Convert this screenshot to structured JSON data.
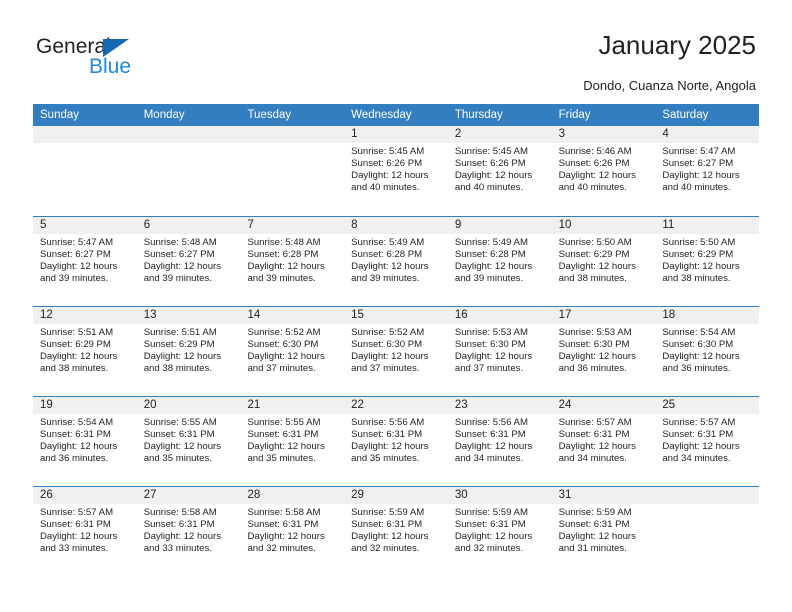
{
  "logo": {
    "text_top": "General",
    "text_bottom": "Blue",
    "triangle_color": "#1668b3",
    "blue_color": "#2288d6"
  },
  "header": {
    "title": "January 2025",
    "subtitle": "Dondo, Cuanza Norte, Angola"
  },
  "theme": {
    "header_blue": "#337ec0",
    "day_band_gray": "#f0f0f0",
    "text_color": "#231f20"
  },
  "calendar": {
    "weekdays": [
      "Sunday",
      "Monday",
      "Tuesday",
      "Wednesday",
      "Thursday",
      "Friday",
      "Saturday"
    ],
    "weeks": [
      [
        {
          "day": "",
          "sunrise": "",
          "sunset": "",
          "daylight_1": "",
          "daylight_2": ""
        },
        {
          "day": "",
          "sunrise": "",
          "sunset": "",
          "daylight_1": "",
          "daylight_2": ""
        },
        {
          "day": "",
          "sunrise": "",
          "sunset": "",
          "daylight_1": "",
          "daylight_2": ""
        },
        {
          "day": "1",
          "sunrise": "Sunrise: 5:45 AM",
          "sunset": "Sunset: 6:26 PM",
          "daylight_1": "Daylight: 12 hours",
          "daylight_2": "and 40 minutes."
        },
        {
          "day": "2",
          "sunrise": "Sunrise: 5:45 AM",
          "sunset": "Sunset: 6:26 PM",
          "daylight_1": "Daylight: 12 hours",
          "daylight_2": "and 40 minutes."
        },
        {
          "day": "3",
          "sunrise": "Sunrise: 5:46 AM",
          "sunset": "Sunset: 6:26 PM",
          "daylight_1": "Daylight: 12 hours",
          "daylight_2": "and 40 minutes."
        },
        {
          "day": "4",
          "sunrise": "Sunrise: 5:47 AM",
          "sunset": "Sunset: 6:27 PM",
          "daylight_1": "Daylight: 12 hours",
          "daylight_2": "and 40 minutes."
        }
      ],
      [
        {
          "day": "5",
          "sunrise": "Sunrise: 5:47 AM",
          "sunset": "Sunset: 6:27 PM",
          "daylight_1": "Daylight: 12 hours",
          "daylight_2": "and 39 minutes."
        },
        {
          "day": "6",
          "sunrise": "Sunrise: 5:48 AM",
          "sunset": "Sunset: 6:27 PM",
          "daylight_1": "Daylight: 12 hours",
          "daylight_2": "and 39 minutes."
        },
        {
          "day": "7",
          "sunrise": "Sunrise: 5:48 AM",
          "sunset": "Sunset: 6:28 PM",
          "daylight_1": "Daylight: 12 hours",
          "daylight_2": "and 39 minutes."
        },
        {
          "day": "8",
          "sunrise": "Sunrise: 5:49 AM",
          "sunset": "Sunset: 6:28 PM",
          "daylight_1": "Daylight: 12 hours",
          "daylight_2": "and 39 minutes."
        },
        {
          "day": "9",
          "sunrise": "Sunrise: 5:49 AM",
          "sunset": "Sunset: 6:28 PM",
          "daylight_1": "Daylight: 12 hours",
          "daylight_2": "and 39 minutes."
        },
        {
          "day": "10",
          "sunrise": "Sunrise: 5:50 AM",
          "sunset": "Sunset: 6:29 PM",
          "daylight_1": "Daylight: 12 hours",
          "daylight_2": "and 38 minutes."
        },
        {
          "day": "11",
          "sunrise": "Sunrise: 5:50 AM",
          "sunset": "Sunset: 6:29 PM",
          "daylight_1": "Daylight: 12 hours",
          "daylight_2": "and 38 minutes."
        }
      ],
      [
        {
          "day": "12",
          "sunrise": "Sunrise: 5:51 AM",
          "sunset": "Sunset: 6:29 PM",
          "daylight_1": "Daylight: 12 hours",
          "daylight_2": "and 38 minutes."
        },
        {
          "day": "13",
          "sunrise": "Sunrise: 5:51 AM",
          "sunset": "Sunset: 6:29 PM",
          "daylight_1": "Daylight: 12 hours",
          "daylight_2": "and 38 minutes."
        },
        {
          "day": "14",
          "sunrise": "Sunrise: 5:52 AM",
          "sunset": "Sunset: 6:30 PM",
          "daylight_1": "Daylight: 12 hours",
          "daylight_2": "and 37 minutes."
        },
        {
          "day": "15",
          "sunrise": "Sunrise: 5:52 AM",
          "sunset": "Sunset: 6:30 PM",
          "daylight_1": "Daylight: 12 hours",
          "daylight_2": "and 37 minutes."
        },
        {
          "day": "16",
          "sunrise": "Sunrise: 5:53 AM",
          "sunset": "Sunset: 6:30 PM",
          "daylight_1": "Daylight: 12 hours",
          "daylight_2": "and 37 minutes."
        },
        {
          "day": "17",
          "sunrise": "Sunrise: 5:53 AM",
          "sunset": "Sunset: 6:30 PM",
          "daylight_1": "Daylight: 12 hours",
          "daylight_2": "and 36 minutes."
        },
        {
          "day": "18",
          "sunrise": "Sunrise: 5:54 AM",
          "sunset": "Sunset: 6:30 PM",
          "daylight_1": "Daylight: 12 hours",
          "daylight_2": "and 36 minutes."
        }
      ],
      [
        {
          "day": "19",
          "sunrise": "Sunrise: 5:54 AM",
          "sunset": "Sunset: 6:31 PM",
          "daylight_1": "Daylight: 12 hours",
          "daylight_2": "and 36 minutes."
        },
        {
          "day": "20",
          "sunrise": "Sunrise: 5:55 AM",
          "sunset": "Sunset: 6:31 PM",
          "daylight_1": "Daylight: 12 hours",
          "daylight_2": "and 35 minutes."
        },
        {
          "day": "21",
          "sunrise": "Sunrise: 5:55 AM",
          "sunset": "Sunset: 6:31 PM",
          "daylight_1": "Daylight: 12 hours",
          "daylight_2": "and 35 minutes."
        },
        {
          "day": "22",
          "sunrise": "Sunrise: 5:56 AM",
          "sunset": "Sunset: 6:31 PM",
          "daylight_1": "Daylight: 12 hours",
          "daylight_2": "and 35 minutes."
        },
        {
          "day": "23",
          "sunrise": "Sunrise: 5:56 AM",
          "sunset": "Sunset: 6:31 PM",
          "daylight_1": "Daylight: 12 hours",
          "daylight_2": "and 34 minutes."
        },
        {
          "day": "24",
          "sunrise": "Sunrise: 5:57 AM",
          "sunset": "Sunset: 6:31 PM",
          "daylight_1": "Daylight: 12 hours",
          "daylight_2": "and 34 minutes."
        },
        {
          "day": "25",
          "sunrise": "Sunrise: 5:57 AM",
          "sunset": "Sunset: 6:31 PM",
          "daylight_1": "Daylight: 12 hours",
          "daylight_2": "and 34 minutes."
        }
      ],
      [
        {
          "day": "26",
          "sunrise": "Sunrise: 5:57 AM",
          "sunset": "Sunset: 6:31 PM",
          "daylight_1": "Daylight: 12 hours",
          "daylight_2": "and 33 minutes."
        },
        {
          "day": "27",
          "sunrise": "Sunrise: 5:58 AM",
          "sunset": "Sunset: 6:31 PM",
          "daylight_1": "Daylight: 12 hours",
          "daylight_2": "and 33 minutes."
        },
        {
          "day": "28",
          "sunrise": "Sunrise: 5:58 AM",
          "sunset": "Sunset: 6:31 PM",
          "daylight_1": "Daylight: 12 hours",
          "daylight_2": "and 32 minutes."
        },
        {
          "day": "29",
          "sunrise": "Sunrise: 5:59 AM",
          "sunset": "Sunset: 6:31 PM",
          "daylight_1": "Daylight: 12 hours",
          "daylight_2": "and 32 minutes."
        },
        {
          "day": "30",
          "sunrise": "Sunrise: 5:59 AM",
          "sunset": "Sunset: 6:31 PM",
          "daylight_1": "Daylight: 12 hours",
          "daylight_2": "and 32 minutes."
        },
        {
          "day": "31",
          "sunrise": "Sunrise: 5:59 AM",
          "sunset": "Sunset: 6:31 PM",
          "daylight_1": "Daylight: 12 hours",
          "daylight_2": "and 31 minutes."
        },
        {
          "day": "",
          "sunrise": "",
          "sunset": "",
          "daylight_1": "",
          "daylight_2": ""
        }
      ]
    ]
  }
}
